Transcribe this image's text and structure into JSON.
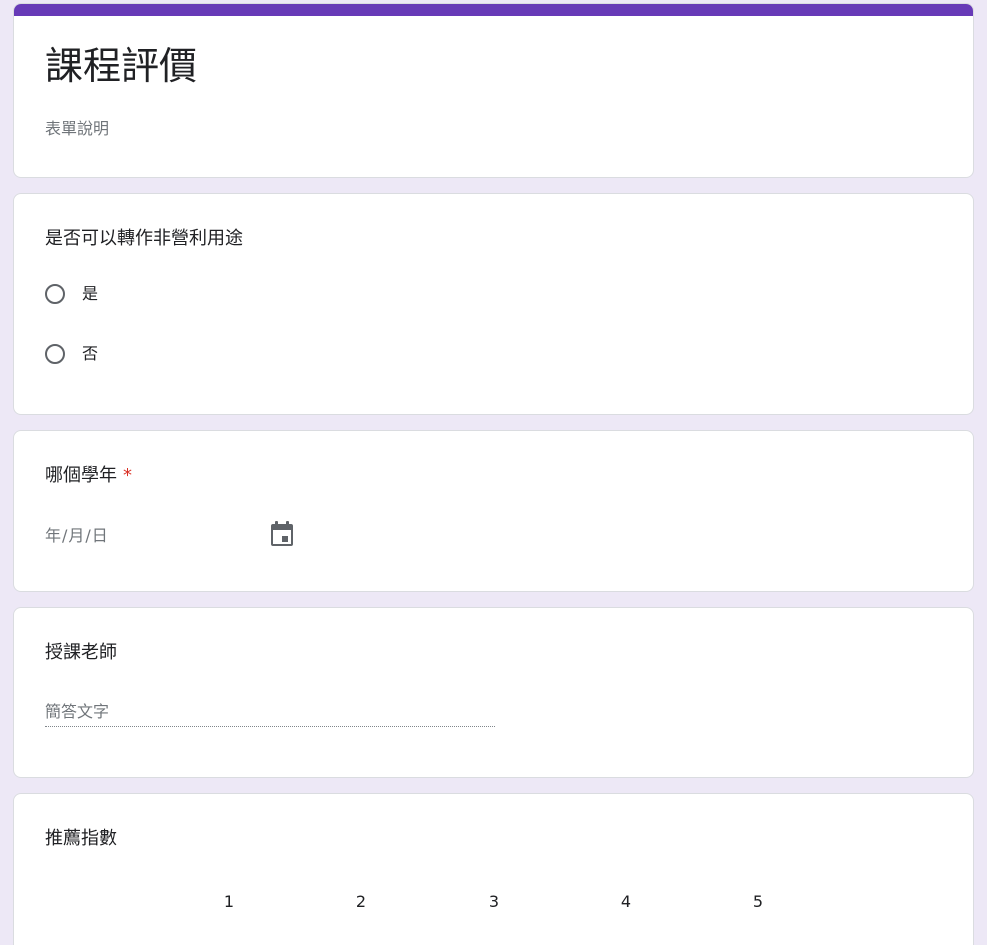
{
  "form": {
    "title": "課程評價",
    "description": "表單說明",
    "accent_color": "#673ab7",
    "background_color": "#ede8f6"
  },
  "questions": {
    "q1": {
      "title": "是否可以轉作非營利用途",
      "type": "radio",
      "options": [
        "是",
        "否"
      ]
    },
    "q2": {
      "title": "哪個學年",
      "required_mark": "*",
      "type": "date",
      "placeholder": "年/月/日",
      "icon": "calendar-icon"
    },
    "q3": {
      "title": "授課老師",
      "type": "short-text",
      "placeholder": "簡答文字"
    },
    "q4": {
      "title": "推薦指數",
      "type": "linear-scale",
      "scale": [
        "1",
        "2",
        "3",
        "4",
        "5"
      ]
    }
  }
}
